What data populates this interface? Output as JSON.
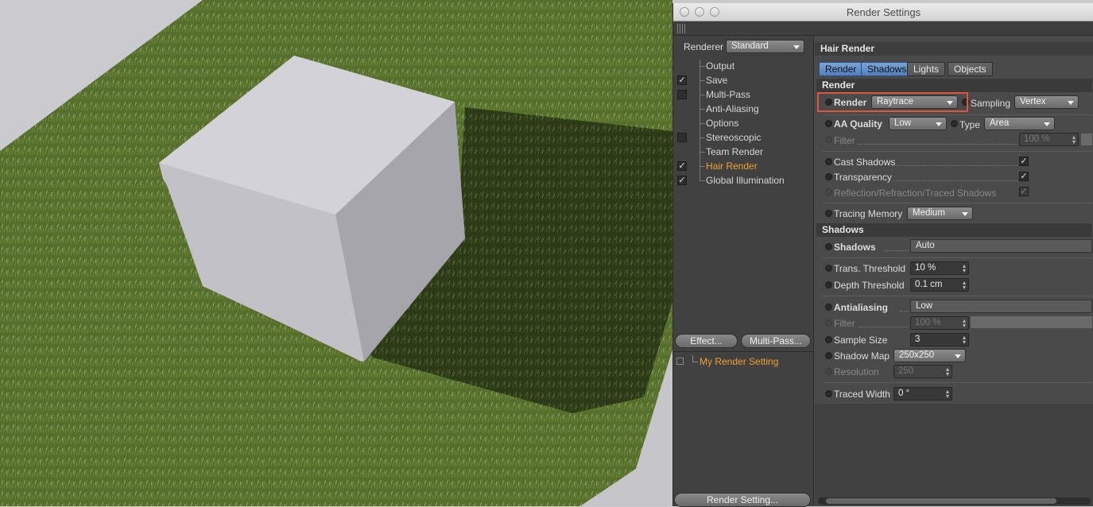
{
  "window": {
    "title": "Render Settings"
  },
  "left": {
    "renderer_label": "Renderer",
    "renderer_value": "Standard",
    "tree": [
      {
        "label": "Output",
        "checked": null,
        "active": false
      },
      {
        "label": "Save",
        "checked": true,
        "active": false
      },
      {
        "label": "Multi-Pass",
        "checked": false,
        "active": false
      },
      {
        "label": "Anti-Aliasing",
        "checked": null,
        "active": false
      },
      {
        "label": "Options",
        "checked": null,
        "active": false
      },
      {
        "label": "Stereoscopic",
        "checked": false,
        "active": false
      },
      {
        "label": "Team Render",
        "checked": null,
        "active": false
      },
      {
        "label": "Hair Render",
        "checked": true,
        "active": true
      },
      {
        "label": "Global Illumination",
        "checked": true,
        "active": false
      }
    ],
    "effect_button": "Effect...",
    "multipass_button": "Multi-Pass...",
    "setting_name": "My Render Setting",
    "render_setting_button": "Render Setting..."
  },
  "right": {
    "panel_title": "Hair Render",
    "tabs": [
      {
        "label": "Render",
        "active": true
      },
      {
        "label": "Shadows",
        "active": true
      },
      {
        "label": "Lights",
        "active": false
      },
      {
        "label": "Objects",
        "active": false
      }
    ],
    "render_section": "Render",
    "render_label": "Render",
    "render_value": "Raytrace",
    "sampling_label": "Sampling",
    "sampling_value": "Vertex",
    "aa_quality_label": "AA Quality",
    "aa_quality_value": "Low",
    "type_label": "Type",
    "type_value": "Area",
    "filter_label": "Filter",
    "filter_value": "100 %",
    "cast_shadows_label": "Cast Shadows",
    "transparency_label": "Transparency",
    "reflection_label": "Reflection/Refraction/Traced Shadows",
    "tracing_memory_label": "Tracing Memory",
    "tracing_memory_value": "Medium",
    "shadows_section": "Shadows",
    "shadows_label": "Shadows",
    "shadows_value": "Auto",
    "trans_threshold_label": "Trans. Threshold",
    "trans_threshold_value": "10 %",
    "depth_threshold_label": "Depth Threshold",
    "depth_threshold_value": "0.1 cm",
    "antialiasing_label": "Antialiasing",
    "antialiasing_value": "Low",
    "filter2_label": "Filter",
    "filter2_value": "100 %",
    "sample_size_label": "Sample Size",
    "sample_size_value": "3",
    "shadow_map_label": "Shadow Map",
    "shadow_map_value": "250x250",
    "resolution_label": "Resolution",
    "resolution_value": "250",
    "traced_width_label": "Traced Width",
    "traced_width_value": "0 °"
  },
  "colors": {
    "accent_active": "#f0a030",
    "tab_active": "#5f8fcf",
    "highlight_box": "#e0533c"
  }
}
